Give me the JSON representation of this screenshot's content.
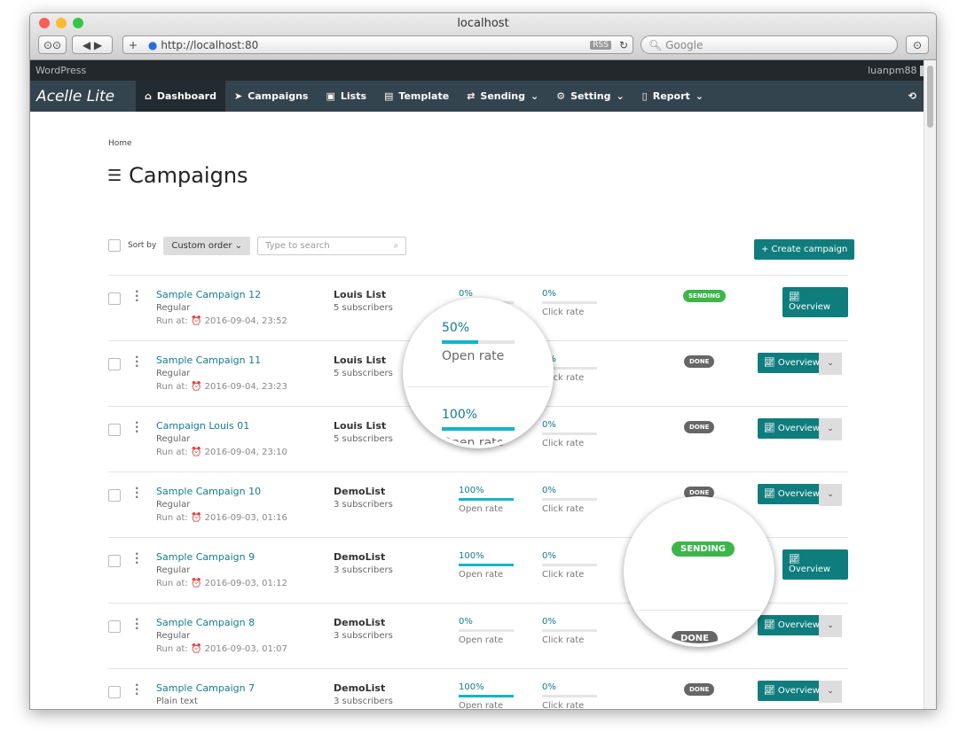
{
  "window": {
    "title": "localhost",
    "url": "http://localhost:80",
    "rss": "RSS",
    "search_placeholder": "Google"
  },
  "wpbar": {
    "label": "WordPress",
    "user": "luanpm88"
  },
  "nav": {
    "logo": "Acelle Lite",
    "items": [
      {
        "label": "Dashboard",
        "icon": "home-icon",
        "active": true
      },
      {
        "label": "Campaigns",
        "icon": "paper-plane-icon"
      },
      {
        "label": "Lists",
        "icon": "address-book-icon"
      },
      {
        "label": "Template",
        "icon": "template-icon"
      },
      {
        "label": "Sending",
        "icon": "exchange-icon",
        "dropdown": true
      },
      {
        "label": "Setting",
        "icon": "gear-icon",
        "dropdown": true
      },
      {
        "label": "Report",
        "icon": "file-icon",
        "dropdown": true
      }
    ]
  },
  "breadcrumb": "Home",
  "page_title": "Campaigns",
  "toolbar": {
    "sort_label": "Sort by",
    "sort_value": "Custom order",
    "search_placeholder": "Type to search",
    "create_label": "+ Create campaign"
  },
  "labels": {
    "run_at": "Run at:",
    "open_rate": "Open rate",
    "click_rate": "Click rate",
    "overview": "Overview"
  },
  "colors": {
    "accent": "#0f7d7d",
    "sending": "#3cb54a",
    "done": "#666666",
    "bar": "#12b5cb"
  },
  "campaigns": [
    {
      "name": "Sample Campaign 12",
      "type": "Regular",
      "run_at": "2016-09-04, 23:52",
      "list": "Louis List",
      "subscribers": "5 subscribers",
      "open": "0%",
      "open_pct": 0,
      "click": "0%",
      "click_pct": 0,
      "status": "SENDING"
    },
    {
      "name": "Sample Campaign 11",
      "type": "Regular",
      "run_at": "2016-09-04, 23:23",
      "list": "Louis List",
      "subscribers": "5 subscribers",
      "open": "50%",
      "open_pct": 50,
      "click": "0%",
      "click_pct": 0,
      "status": "DONE"
    },
    {
      "name": "Campaign Louis 01",
      "type": "Regular",
      "run_at": "2016-09-04, 23:10",
      "list": "Louis List",
      "subscribers": "5 subscribers",
      "open": "100%",
      "open_pct": 100,
      "click": "0%",
      "click_pct": 0,
      "status": "DONE"
    },
    {
      "name": "Sample Campaign 10",
      "type": "Regular",
      "run_at": "2016-09-03, 01:16",
      "list": "DemoList",
      "subscribers": "3 subscribers",
      "open": "100%",
      "open_pct": 100,
      "click": "0%",
      "click_pct": 0,
      "status": "DONE"
    },
    {
      "name": "Sample Campaign 9",
      "type": "Regular",
      "run_at": "2016-09-03, 01:12",
      "list": "DemoList",
      "subscribers": "3 subscribers",
      "open": "100%",
      "open_pct": 100,
      "click": "0%",
      "click_pct": 0,
      "status": "SENDING"
    },
    {
      "name": "Sample Campaign 8",
      "type": "Regular",
      "run_at": "2016-09-03, 01:07",
      "list": "DemoList",
      "subscribers": "3 subscribers",
      "open": "0%",
      "open_pct": 0,
      "click": "0%",
      "click_pct": 0,
      "status": "DONE"
    },
    {
      "name": "Sample Campaign 7",
      "type": "Plain text",
      "list": "DemoList",
      "subscribers": "3 subscribers",
      "open": "100%",
      "open_pct": 100,
      "click": "0%",
      "click_pct": 0,
      "status": "DONE"
    }
  ]
}
